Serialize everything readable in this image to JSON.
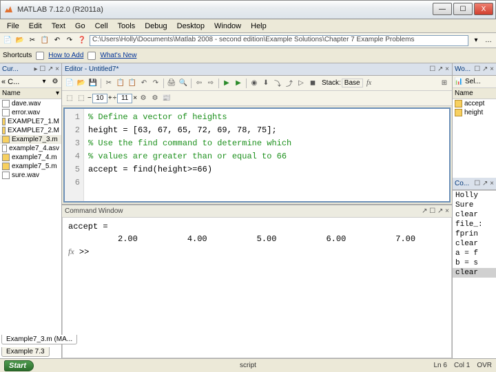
{
  "window": {
    "title": "MATLAB 7.12.0 (R2011a)",
    "buttons": {
      "min": "—",
      "max": "☐",
      "close": "X"
    }
  },
  "menubar": [
    "File",
    "Edit",
    "Text",
    "Go",
    "Cell",
    "Tools",
    "Debug",
    "Desktop",
    "Window",
    "Help"
  ],
  "address": {
    "path": "C:\\Users\\Holly\\Documents\\Matlab 2008 - second edition\\Example Solutions\\Chapter 7 Example Problems"
  },
  "shortcuts": {
    "label": "Shortcuts",
    "howto": "How to Add",
    "whatsnew": "What's New"
  },
  "current_folder": {
    "title": "Cur...",
    "combo": "« C...",
    "header": "Name",
    "files": [
      {
        "name": "dave.wav",
        "sel": false
      },
      {
        "name": "error.wav",
        "sel": false
      },
      {
        "name": "EXAMPLE7_1.M",
        "sel": false
      },
      {
        "name": "EXAMPLE7_2.M",
        "sel": false
      },
      {
        "name": "Example7_3.m",
        "sel": true
      },
      {
        "name": "example7_4.asv",
        "sel": false
      },
      {
        "name": "example7_4.m",
        "sel": false
      },
      {
        "name": "example7_5.m",
        "sel": false
      },
      {
        "name": "sure.wav",
        "sel": false
      }
    ]
  },
  "editor": {
    "title": "Editor - Untitled7*",
    "toolbar": {
      "num1": "10",
      "num2": "11"
    },
    "stack_label": "Stack:",
    "base_label": "Base",
    "fx_label": "fx",
    "lines": [
      {
        "n": "1",
        "cls": "cm",
        "text": "% Define a vector of heights"
      },
      {
        "n": "2",
        "cls": "kw",
        "text": "height = [63, 67, 65, 72, 69, 78, 75];"
      },
      {
        "n": "3",
        "cls": "cm",
        "text": "% Use the find command to determine which"
      },
      {
        "n": "4",
        "cls": "cm",
        "text": "% values are greater than or equal to 66"
      },
      {
        "n": "5",
        "cls": "kw",
        "text": "accept = find(height>=66)"
      },
      {
        "n": "6",
        "cls": "kw",
        "text": ""
      }
    ]
  },
  "command_window": {
    "title": "Command Window",
    "output_var": "accept =",
    "output_vals": "          2.00          4.00          5.00          6.00          7.00",
    "prompt": ">> ",
    "fx": "fx"
  },
  "workspace": {
    "title": "Wo...",
    "sel_label": "Sel...",
    "header": "Name",
    "vars": [
      "accept",
      "height"
    ]
  },
  "cmd_history": {
    "title": "Co...",
    "items": [
      "Holly",
      "Sure",
      "clear",
      "file_:",
      "fprin",
      "clear",
      "a = f",
      "b = s",
      "clear"
    ],
    "sel_index": 8
  },
  "bottom_tabs": {
    "tab1": "Example7_3.m (MA...",
    "tab2": "Example 7.3"
  },
  "statusbar": {
    "start": "Start",
    "script": "script",
    "ln": "Ln 6",
    "col": "Col 1",
    "ovr": "OVR"
  }
}
